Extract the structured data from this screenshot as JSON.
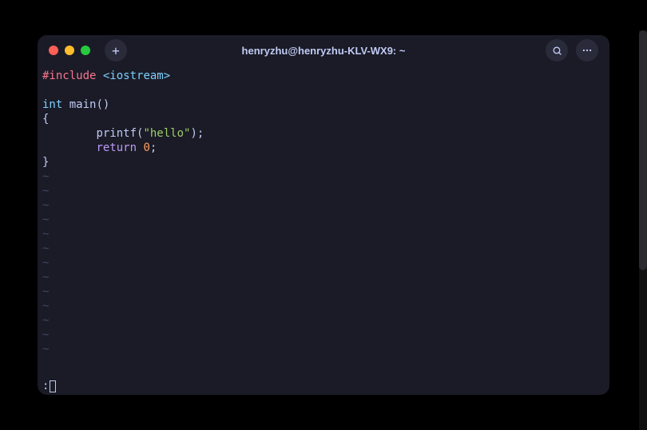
{
  "window": {
    "title": "henryzhu@henryzhu-KLV-WX9: ~"
  },
  "titlebar": {
    "new_tab_label": "+"
  },
  "code": {
    "line1": {
      "directive": "#include",
      "header": "<iostream>"
    },
    "line3": {
      "type": "int",
      "name": "main",
      "parens": "()"
    },
    "line4": "{",
    "line5": {
      "indent": "        ",
      "func": "printf",
      "open": "(",
      "string": "\"hello\"",
      "close": ");"
    },
    "line6": {
      "indent": "        ",
      "keyword": "return",
      "space": " ",
      "number": "0",
      "semi": ";"
    },
    "line7": "}",
    "tilde": "~"
  },
  "command": {
    "prompt": ":"
  }
}
